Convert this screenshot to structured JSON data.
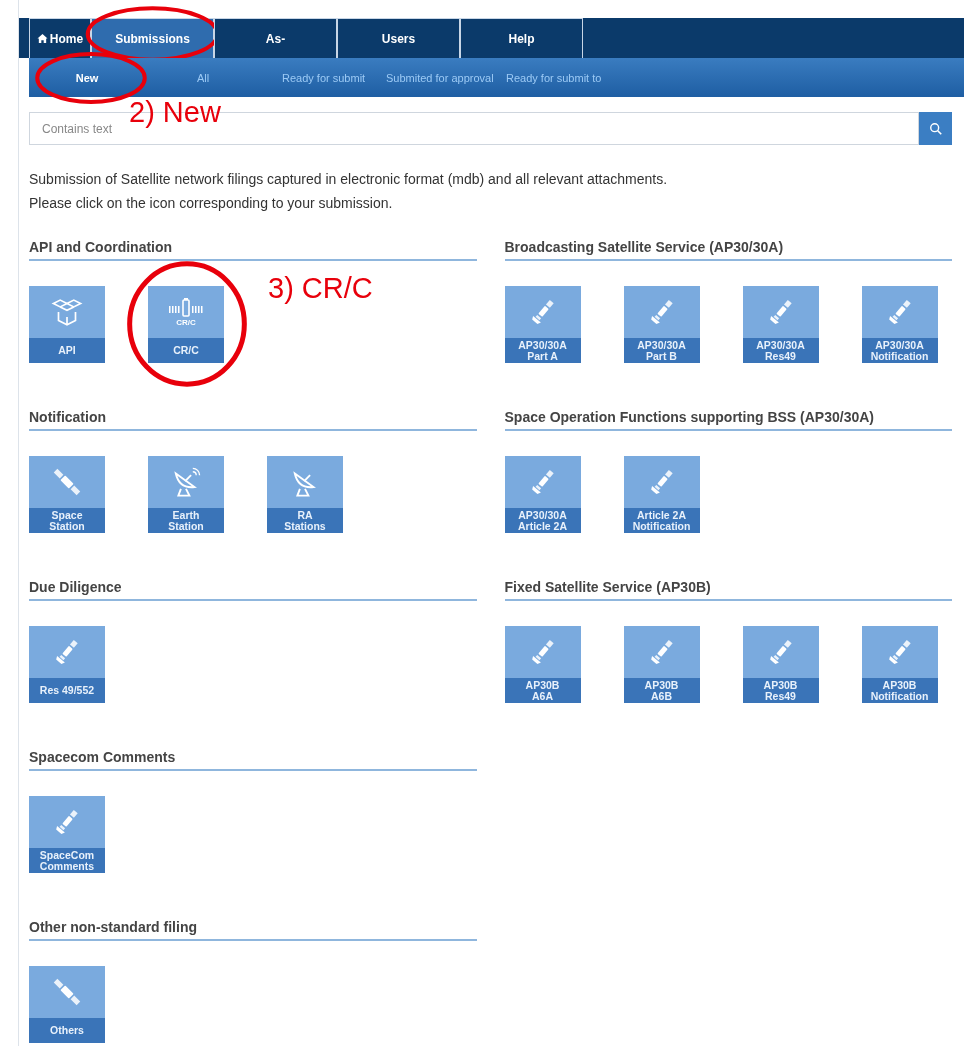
{
  "nav": {
    "tabs": [
      {
        "label": "Home",
        "kind": "home",
        "selected": false,
        "circled": false
      },
      {
        "label": "Submissions",
        "kind": "plain",
        "selected": true,
        "circled": true
      },
      {
        "label": "As-",
        "kind": "plain",
        "selected": false,
        "circled": false
      },
      {
        "label": "Users",
        "kind": "plain",
        "selected": false,
        "circled": false
      },
      {
        "label": "Help",
        "kind": "plain",
        "selected": false,
        "circled": false
      }
    ],
    "subnav": [
      {
        "label": "New",
        "selected": true,
        "circled": true,
        "callout": "2) New"
      },
      {
        "label": "All",
        "selected": false,
        "circled": false
      },
      {
        "label": "Ready for submit",
        "selected": false,
        "circled": false
      },
      {
        "label": "Submited for approval",
        "selected": false,
        "circled": false
      },
      {
        "label": "Ready for submit to",
        "selected": false,
        "circled": false
      }
    ]
  },
  "search": {
    "placeholder": "Contains text"
  },
  "intro": [
    "Submission of Satellite network filings captured in electronic format (mdb) and all relevant attachments.",
    "Please click on the icon corresponding to your submission."
  ],
  "columns": [
    [
      {
        "title": "API and Coordination",
        "tiles": [
          {
            "kind": "boxes",
            "label": [
              "API"
            ],
            "circled": false
          },
          {
            "kind": "crc",
            "badge": "CR/C",
            "label": [
              "CR/C"
            ],
            "circled": true,
            "callout": "3) CR/C"
          }
        ]
      },
      {
        "title": "Notification",
        "tiles": [
          {
            "kind": "station",
            "label": [
              "Space",
              "Station"
            ],
            "circled": false
          },
          {
            "kind": "earth",
            "label": [
              "Earth",
              "Station"
            ],
            "circled": false
          },
          {
            "kind": "dish",
            "label": [
              "RA",
              "Stations"
            ],
            "circled": false
          }
        ]
      },
      {
        "title": "Due Diligence",
        "tiles": [
          {
            "kind": "satellite",
            "label": [
              "Res 49/552"
            ],
            "circled": false
          }
        ]
      },
      {
        "title": "Spacecom Comments",
        "tiles": [
          {
            "kind": "satellite",
            "label": [
              "SpaceCom",
              "Comments"
            ],
            "circled": false
          }
        ]
      },
      {
        "title": "Other non-standard filing",
        "tiles": [
          {
            "kind": "station",
            "label": [
              "Others"
            ],
            "circled": false
          }
        ]
      }
    ],
    [
      {
        "title": "Broadcasting Satellite Service (AP30/30A)",
        "tiles": [
          {
            "kind": "satellite",
            "label": [
              "AP30/30A",
              "Part A"
            ],
            "circled": false
          },
          {
            "kind": "satellite",
            "label": [
              "AP30/30A",
              "Part B"
            ],
            "circled": false
          },
          {
            "kind": "satellite",
            "label": [
              "AP30/30A",
              "Res49"
            ],
            "circled": false
          },
          {
            "kind": "satellite",
            "label": [
              "AP30/30A",
              "Notification"
            ],
            "circled": false
          }
        ]
      },
      {
        "title": "Space Operation Functions supporting BSS (AP30/30A)",
        "tiles": [
          {
            "kind": "satellite",
            "label": [
              "AP30/30A",
              "Article 2A"
            ],
            "circled": false
          },
          {
            "kind": "satellite",
            "label": [
              "Article 2A",
              "Notification"
            ],
            "circled": false
          }
        ]
      },
      {
        "title": "Fixed Satellite Service (AP30B)",
        "tiles": [
          {
            "kind": "satellite",
            "label": [
              "AP30B",
              "A6A"
            ],
            "circled": false
          },
          {
            "kind": "satellite",
            "label": [
              "AP30B",
              "A6B"
            ],
            "circled": false
          },
          {
            "kind": "satellite",
            "label": [
              "AP30B",
              "Res49"
            ],
            "circled": false
          },
          {
            "kind": "satellite",
            "label": [
              "AP30B",
              "Notification"
            ],
            "circled": false
          }
        ]
      }
    ]
  ]
}
